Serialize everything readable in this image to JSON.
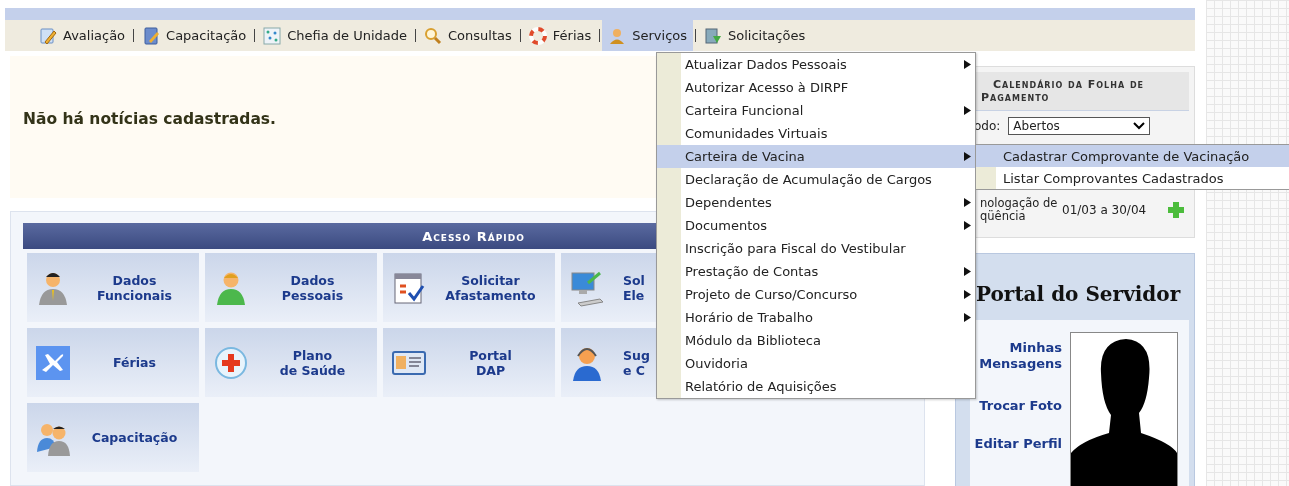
{
  "menu_bar": [
    {
      "label": "Avaliação",
      "selected": false
    },
    {
      "label": "Capacitação",
      "selected": false
    },
    {
      "label": "Chefia de Unidade",
      "selected": false
    },
    {
      "label": "Consultas",
      "selected": false
    },
    {
      "label": "Férias",
      "selected": false
    },
    {
      "label": "Serviços",
      "selected": true
    },
    {
      "label": "Solicitações",
      "selected": false
    }
  ],
  "news": {
    "message": "Não há notícias cadastradas."
  },
  "quick_access": {
    "title": "Acesso Rápido",
    "tiles": [
      {
        "lines": [
          "Dados",
          "Funcionais"
        ],
        "cut": false
      },
      {
        "lines": [
          "Dados",
          "Pessoais"
        ],
        "cut": false
      },
      {
        "lines": [
          "Solicitar",
          "Afastamento"
        ],
        "cut": false
      },
      {
        "lines": [
          "Sol",
          "Ele"
        ],
        "cut": true
      },
      {
        "lines": [
          "Férias"
        ],
        "cut": false
      },
      {
        "lines": [
          "Plano",
          "de Saúde"
        ],
        "cut": false
      },
      {
        "lines": [
          "Portal",
          "DAP"
        ],
        "cut": false
      },
      {
        "lines": [
          "Sug",
          "e C"
        ],
        "cut": true
      },
      {
        "lines": [
          "Capacitação"
        ],
        "cut": false
      }
    ]
  },
  "calendar": {
    "title_lines": [
      "Calendário da Folha de",
      "Pagamento"
    ],
    "period_label": "odo:",
    "period_value": "Abertos",
    "rows": [
      {
        "lines": [
          "nologação de",
          "qüência"
        ],
        "dates": "01/03 a 30/04"
      }
    ]
  },
  "portal": {
    "title": "Portal do Servidor",
    "links": [
      "Minhas Mensagens",
      "Trocar Foto",
      "Editar Perfil"
    ]
  },
  "dropdown": {
    "items": [
      {
        "label": "Atualizar Dados Pessoais",
        "submenu": true,
        "selected": false
      },
      {
        "label": "Autorizar Acesso à DIRPF",
        "submenu": false,
        "selected": false
      },
      {
        "label": "Carteira Funcional",
        "submenu": true,
        "selected": false
      },
      {
        "label": "Comunidades Virtuais",
        "submenu": false,
        "selected": false
      },
      {
        "label": "Carteira de Vacina",
        "submenu": true,
        "selected": true
      },
      {
        "label": "Declaração de Acumulação de Cargos",
        "submenu": false,
        "selected": false
      },
      {
        "label": "Dependentes",
        "submenu": true,
        "selected": false
      },
      {
        "label": "Documentos",
        "submenu": true,
        "selected": false
      },
      {
        "label": "Inscrição para Fiscal do Vestibular",
        "submenu": false,
        "selected": false
      },
      {
        "label": "Prestação de Contas",
        "submenu": true,
        "selected": false
      },
      {
        "label": "Projeto de Curso/Concurso",
        "submenu": true,
        "selected": false
      },
      {
        "label": "Horário de Trabalho",
        "submenu": true,
        "selected": false
      },
      {
        "label": "Módulo da Biblioteca",
        "submenu": false,
        "selected": false
      },
      {
        "label": "Ouvidoria",
        "submenu": false,
        "selected": false
      },
      {
        "label": "Relatório de Aquisições",
        "submenu": false,
        "selected": false
      }
    ],
    "submenu": [
      {
        "label": "Cadastrar Comprovante de Vacinação",
        "selected": true
      },
      {
        "label": "Listar Comprovantes Cadastrados",
        "selected": false
      }
    ]
  }
}
